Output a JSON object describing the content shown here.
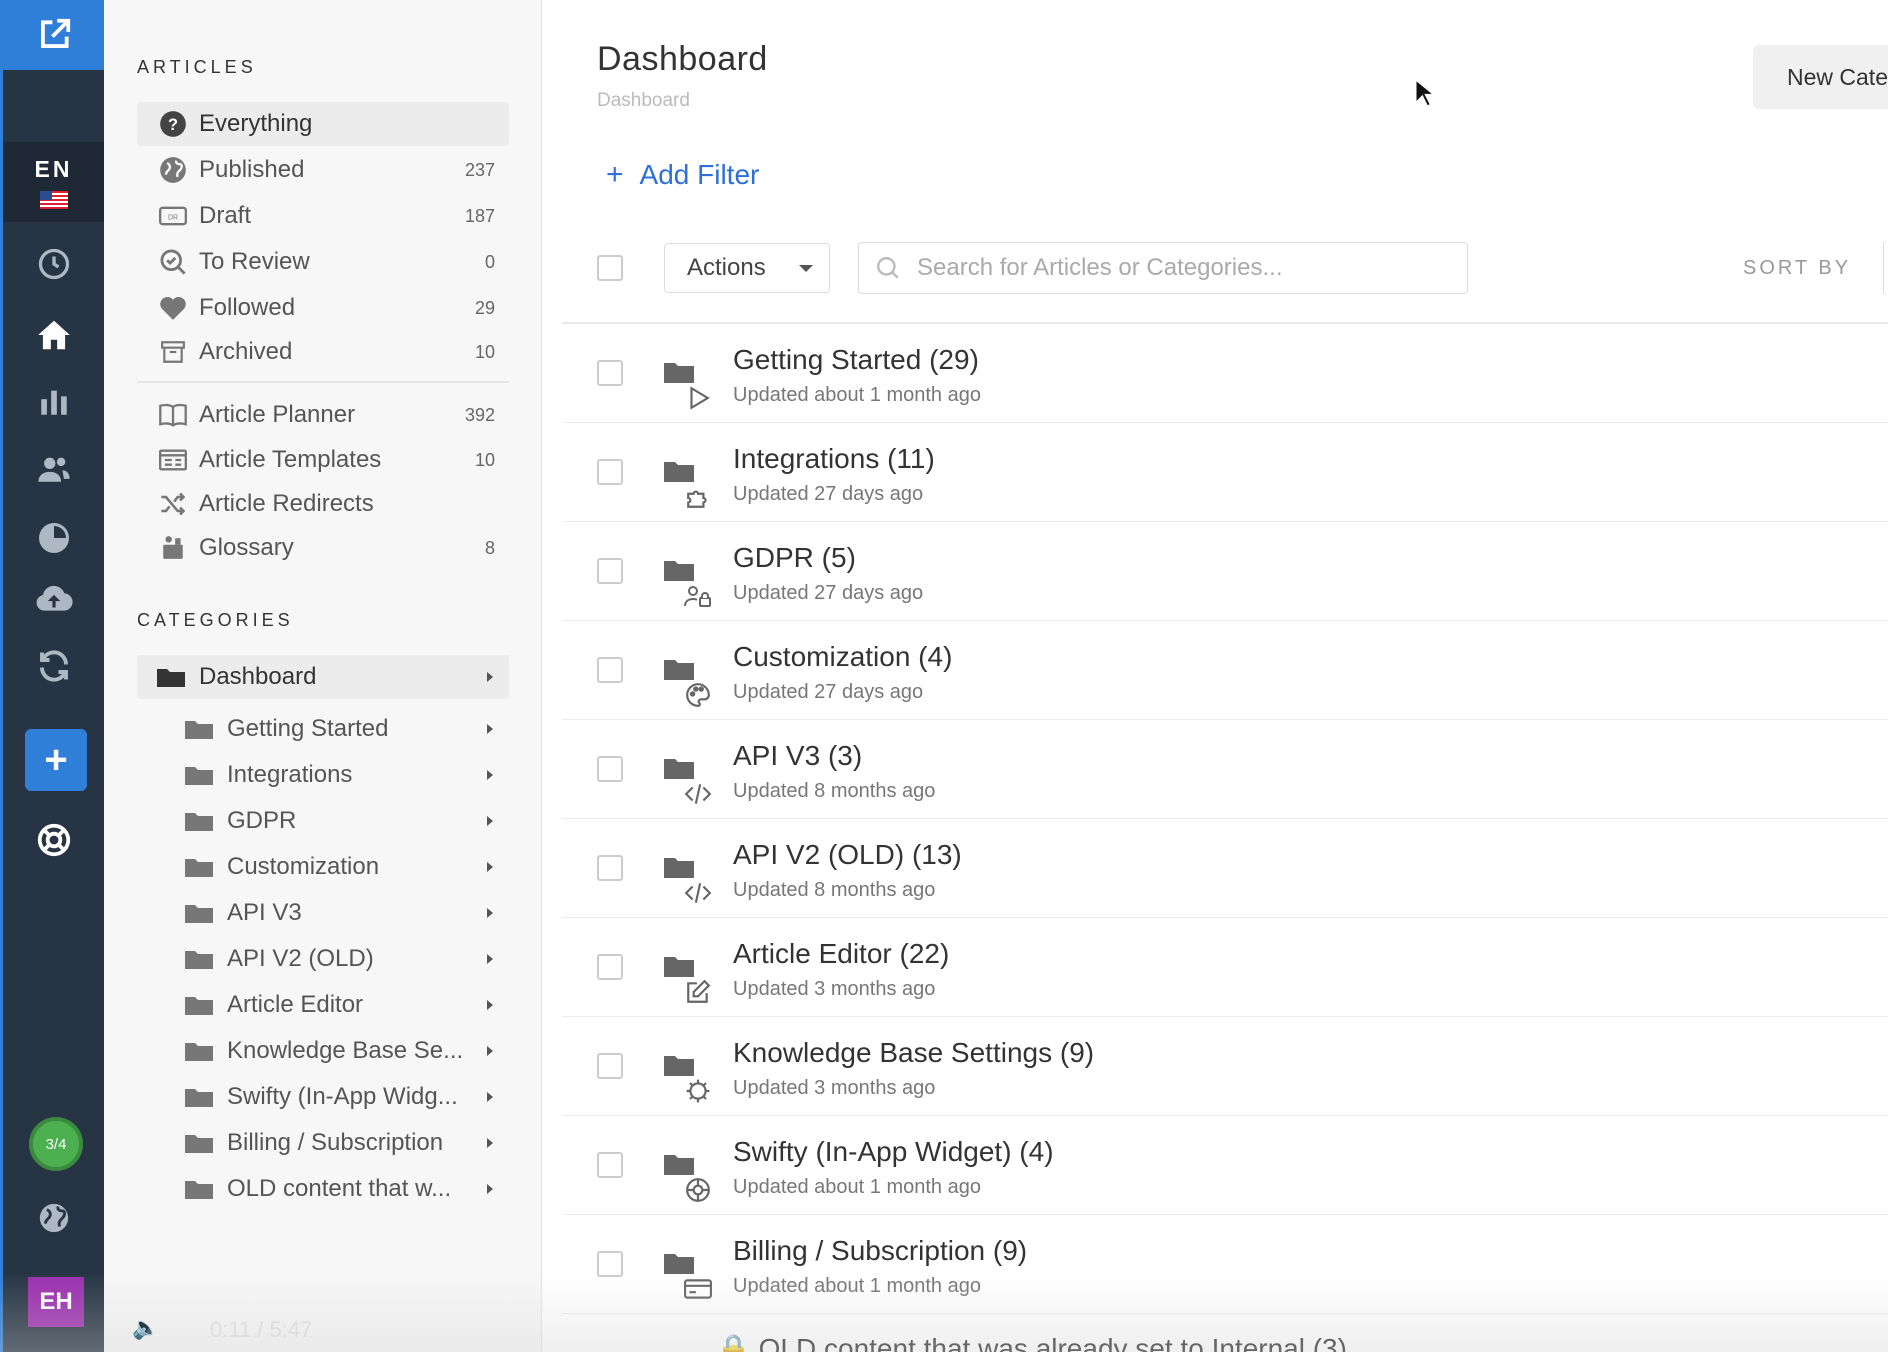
{
  "rail": {
    "language": "EN",
    "plus_label": "+",
    "progress": "3/4",
    "avatar": "EH",
    "icons": [
      "external-edit-icon",
      "history-icon",
      "home-icon",
      "analytics-icon",
      "users-icon",
      "search-chart-icon",
      "cloud-upload-icon",
      "sync-icon",
      "help-lifebuoy-icon",
      "globe-icon"
    ]
  },
  "sidebar": {
    "articles_title": "ARTICLES",
    "articles": [
      {
        "label": "Everything",
        "count": ""
      },
      {
        "label": "Published",
        "count": "237"
      },
      {
        "label": "Draft",
        "count": "187"
      },
      {
        "label": "To Review",
        "count": "0"
      },
      {
        "label": "Followed",
        "count": "29"
      },
      {
        "label": "Archived",
        "count": "10"
      }
    ],
    "tools": [
      {
        "label": "Article Planner",
        "count": "392"
      },
      {
        "label": "Article Templates",
        "count": "10"
      },
      {
        "label": "Article Redirects",
        "count": ""
      },
      {
        "label": "Glossary",
        "count": "8"
      }
    ],
    "categories_title": "CATEGORIES",
    "root_category": "Dashboard",
    "categories": [
      "Getting Started",
      "Integrations",
      "GDPR",
      "Customization",
      "API V3",
      "API V2 (OLD)",
      "Article Editor",
      "Knowledge Base Se...",
      "Swifty (In-App Widg...",
      "Billing / Subscription",
      "OLD content that w..."
    ]
  },
  "main": {
    "title": "Dashboard",
    "breadcrumb": "Dashboard",
    "new_button": "New Cate",
    "add_filter": "Add Filter",
    "actions": "Actions",
    "search_placeholder": "Search for Articles or Categories...",
    "sort_by": "SORT BY",
    "rows": [
      {
        "title": "Getting Started (29)",
        "updated": "Updated about 1 month ago",
        "icon": "play-icon"
      },
      {
        "title": "Integrations (11)",
        "updated": "Updated 27 days ago",
        "icon": "puzzle-icon"
      },
      {
        "title": "GDPR (5)",
        "updated": "Updated 27 days ago",
        "icon": "user-lock-icon"
      },
      {
        "title": "Customization (4)",
        "updated": "Updated 27 days ago",
        "icon": "palette-icon"
      },
      {
        "title": "API V3 (3)",
        "updated": "Updated 8 months ago",
        "icon": "code-icon"
      },
      {
        "title": "API V2 (OLD) (13)",
        "updated": "Updated 8 months ago",
        "icon": "code-icon"
      },
      {
        "title": "Article Editor (22)",
        "updated": "Updated 3 months ago",
        "icon": "edit-icon"
      },
      {
        "title": "Knowledge Base Settings (9)",
        "updated": "Updated 3 months ago",
        "icon": "gear-icon"
      },
      {
        "title": "Swifty (In-App Widget) (4)",
        "updated": "Updated about 1 month ago",
        "icon": "lifebuoy-icon"
      },
      {
        "title": "Billing / Subscription (9)",
        "updated": "Updated about 1 month ago",
        "icon": "credit-card-icon"
      }
    ],
    "partial_row": "OLD content that was already set to Internal (3)"
  },
  "video": {
    "time": "0:11 / 5:47"
  }
}
